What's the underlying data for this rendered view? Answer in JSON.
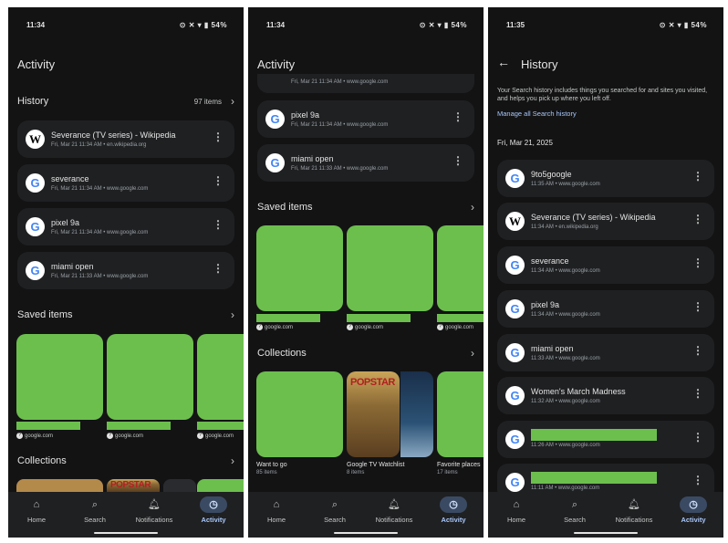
{
  "status": {
    "time1": "11:34",
    "time2": "11:34",
    "time3": "11:35",
    "icons": "⊙ ✕ ▾ ▮ 54%"
  },
  "screen1": {
    "title": "Activity",
    "history_label": "History",
    "history_count": "97 items",
    "history": [
      {
        "title": "Severance (TV series) - Wikipedia",
        "sub": "Fri, Mar 21 11:34 AM • en.wikipedia.org",
        "logo": "W"
      },
      {
        "title": "severance",
        "sub": "Fri, Mar 21 11:34 AM • www.google.com",
        "logo": "G"
      },
      {
        "title": "pixel 9a",
        "sub": "Fri, Mar 21 11:34 AM • www.google.com",
        "logo": "G"
      },
      {
        "title": "miami open",
        "sub": "Fri, Mar 21 11:33 AM • www.google.com",
        "logo": "G"
      }
    ],
    "saved_label": "Saved items",
    "saved_src": "google.com",
    "collections_label": "Collections",
    "popstar": "POPSTAR"
  },
  "screen2": {
    "title": "Activity",
    "partial_sub": "Fri, Mar 21 11:34 AM • www.google.com",
    "history": [
      {
        "title": "pixel 9a",
        "sub": "Fri, Mar 21 11:34 AM • www.google.com",
        "logo": "G"
      },
      {
        "title": "miami open",
        "sub": "Fri, Mar 21 11:33 AM • www.google.com",
        "logo": "G"
      }
    ],
    "saved_label": "Saved items",
    "saved_src": "google.com",
    "collections_label": "Collections",
    "collections": [
      {
        "title": "Want to go",
        "sub": "85 items"
      },
      {
        "title": "Google TV Watchlist",
        "sub": "8 items"
      },
      {
        "title": "Favorite places",
        "sub": "17 items"
      }
    ],
    "popstar": "POPSTAR"
  },
  "screen3": {
    "title": "History",
    "description": "Your Search history includes things you searched for and sites you visited, and helps you pick up where you left off.",
    "manage_link": "Manage all Search history",
    "date": "Fri, Mar 21, 2025",
    "history": [
      {
        "title": "9to5google",
        "sub": "11:35 AM • www.google.com",
        "logo": "G"
      },
      {
        "title": "Severance (TV series) - Wikipedia",
        "sub": "11:34 AM • en.wikipedia.org",
        "logo": "W"
      },
      {
        "title": "severance",
        "sub": "11:34 AM • www.google.com",
        "logo": "G"
      },
      {
        "title": "pixel 9a",
        "sub": "11:34 AM • www.google.com",
        "logo": "G"
      },
      {
        "title": "miami open",
        "sub": "11:33 AM • www.google.com",
        "logo": "G"
      },
      {
        "title": "Women's March Madness",
        "sub": "11:32 AM • www.google.com",
        "logo": "G"
      },
      {
        "title": "",
        "sub": "11:26 AM • www.google.com",
        "logo": "G"
      },
      {
        "title": "",
        "sub": "11:11 AM • www.google.com",
        "logo": "G"
      }
    ]
  },
  "nav": {
    "home": "Home",
    "search": "Search",
    "notifications": "Notifications",
    "activity": "Activity"
  },
  "icons": {
    "wiki": "W",
    "google": "G",
    "more": "⋮",
    "chevron": "›",
    "back": "←"
  },
  "colors": {
    "background": "#131314",
    "card": "#1f2022",
    "accent": "#a8c7fa",
    "placeholder": "#6cbf4d"
  }
}
